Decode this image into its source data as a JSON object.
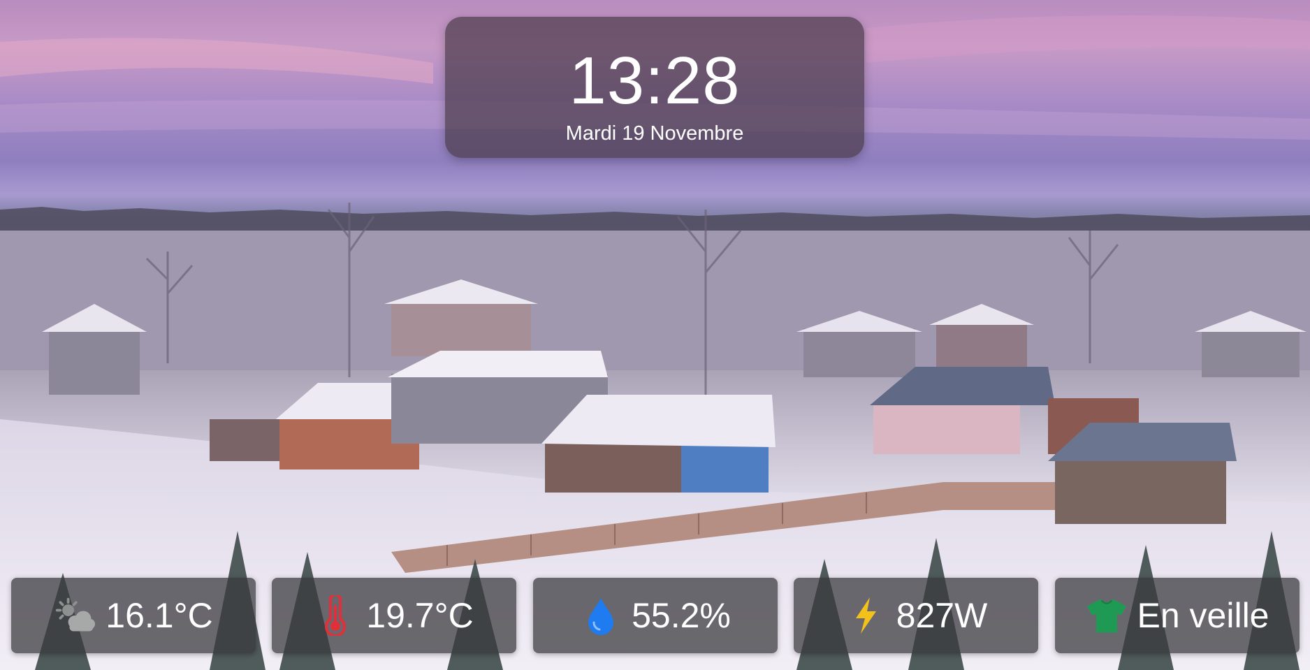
{
  "clock": {
    "time": "13:28",
    "date": "Mardi 19 Novembre"
  },
  "tiles": [
    {
      "id": "outdoor-temperature",
      "icon": "partly-cloudy-icon",
      "value": "16.1°C"
    },
    {
      "id": "indoor-temperature",
      "icon": "thermometer-icon",
      "value": "19.7°C",
      "accent": "#e0303a"
    },
    {
      "id": "humidity",
      "icon": "water-drop-icon",
      "value": "55.2%",
      "accent": "#1e7cf0"
    },
    {
      "id": "power",
      "icon": "lightning-bolt-icon",
      "value": "827W",
      "accent": "#f2c21b"
    },
    {
      "id": "washing-machine",
      "icon": "tshirt-icon",
      "value": "En veille",
      "accent": "#1f9a55"
    }
  ]
}
